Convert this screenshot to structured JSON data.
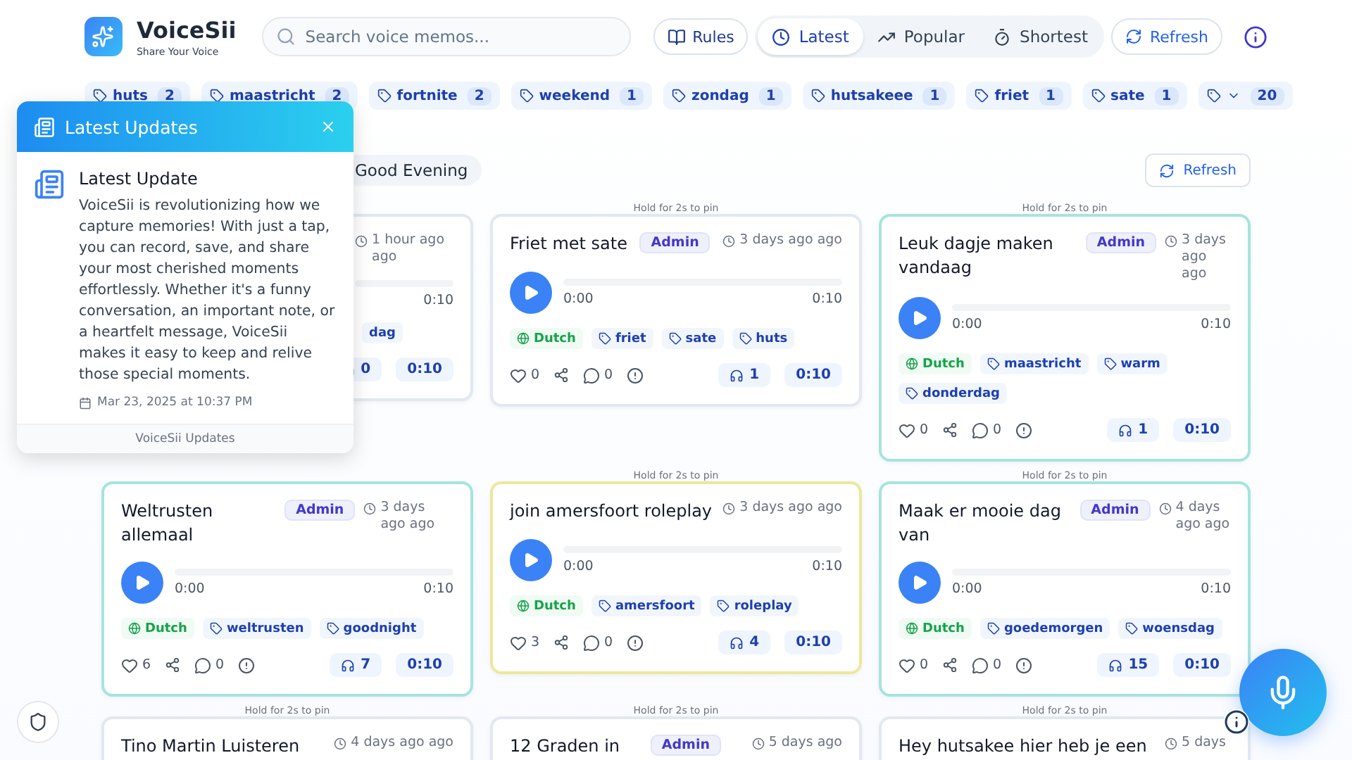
{
  "brand": {
    "name": "VoiceSii",
    "tagline": "Share Your Voice"
  },
  "search": {
    "placeholder": "Search voice memos..."
  },
  "nav": [
    {
      "kind": "link",
      "label": "Rules"
    },
    {
      "kind": "sort",
      "label": "Latest",
      "selected": true
    },
    {
      "kind": "sort",
      "label": "Popular",
      "selected": false
    },
    {
      "kind": "sort",
      "label": "Shortest",
      "selected": false
    },
    {
      "kind": "action",
      "label": "Refresh"
    }
  ],
  "tags": [
    {
      "kind": "tag",
      "label": "huts",
      "count": "2"
    },
    {
      "kind": "tag",
      "label": "maastricht",
      "count": "2"
    },
    {
      "kind": "tag",
      "label": "fortnite",
      "count": "2"
    },
    {
      "kind": "tag",
      "label": "weekend",
      "count": "1"
    },
    {
      "kind": "tag",
      "label": "zondag",
      "count": "1"
    },
    {
      "kind": "tag",
      "label": "hutsakeee",
      "count": "1"
    },
    {
      "kind": "tag",
      "label": "friet",
      "count": "1"
    },
    {
      "kind": "tag",
      "label": "sate",
      "count": "1"
    },
    {
      "kind": "more",
      "count": "20"
    }
  ],
  "greeting": "Good Evening",
  "refresh": "Refresh",
  "cards": [
    {
      "kind": "partial",
      "color": "#e2e8f0",
      "time": "1 hour ago ago",
      "audio": {
        "end": "0:10"
      },
      "tags": [
        {
          "kind": "tag",
          "label": "dag"
        }
      ],
      "listens": "0",
      "duration": "0:10"
    },
    {
      "kind": "full",
      "color": "#e2e8f0",
      "pin_hint": "Hold for 2s to pin",
      "title": "Friet met sate",
      "admin": "Admin",
      "time": "3 days ago ago",
      "audio": {
        "start": "0:00",
        "end": "0:10"
      },
      "tags": [
        {
          "kind": "language",
          "label": "Dutch"
        },
        {
          "kind": "tag",
          "label": "friet"
        },
        {
          "kind": "tag",
          "label": "sate"
        },
        {
          "kind": "tag",
          "label": "huts"
        }
      ],
      "likes": "0",
      "comments": "0",
      "listens": "1",
      "duration": "0:10"
    },
    {
      "kind": "full",
      "color": "#a5e4df",
      "pin_hint": "Hold for 2s to pin",
      "title": "Leuk dagje maken vandaag",
      "admin": "Admin",
      "time": "3 days ago ago",
      "audio": {
        "start": "0:00",
        "end": "0:10"
      },
      "tags": [
        {
          "kind": "language",
          "label": "Dutch"
        },
        {
          "kind": "tag",
          "label": "maastricht"
        },
        {
          "kind": "tag",
          "label": "warm"
        },
        {
          "kind": "tag",
          "label": "donderdag"
        }
      ],
      "likes": "0",
      "comments": "0",
      "listens": "1",
      "duration": "0:10"
    },
    {
      "kind": "full",
      "color": "#a5e4df",
      "title": "Weltrusten allemaal",
      "admin": "Admin",
      "time": "3 days ago ago",
      "audio": {
        "start": "0:00",
        "end": "0:10"
      },
      "tags": [
        {
          "kind": "language",
          "label": "Dutch"
        },
        {
          "kind": "tag",
          "label": "weltrusten"
        },
        {
          "kind": "tag",
          "label": "goodnight"
        }
      ],
      "likes": "6",
      "comments": "0",
      "listens": "7",
      "duration": "0:10"
    },
    {
      "kind": "full",
      "color": "#ece89a",
      "pin_hint": "Hold for 2s to pin",
      "title": "join amersfoort roleplay",
      "time": "3 days ago ago",
      "audio": {
        "start": "0:00",
        "end": "0:10"
      },
      "tags": [
        {
          "kind": "language",
          "label": "Dutch"
        },
        {
          "kind": "tag",
          "label": "amersfoort"
        },
        {
          "kind": "tag",
          "label": "roleplay"
        }
      ],
      "likes": "3",
      "comments": "0",
      "listens": "4",
      "duration": "0:10"
    },
    {
      "kind": "full",
      "color": "#a5e4df",
      "pin_hint": "Hold for 2s to pin",
      "title": "Maak er mooie dag van",
      "admin": "Admin",
      "time": "4 days ago ago",
      "audio": {
        "start": "0:00",
        "end": "0:10"
      },
      "tags": [
        {
          "kind": "language",
          "label": "Dutch"
        },
        {
          "kind": "tag",
          "label": "goedemorgen"
        },
        {
          "kind": "tag",
          "label": "woensdag"
        }
      ],
      "likes": "0",
      "comments": "0",
      "listens": "15",
      "duration": "0:10"
    },
    {
      "kind": "full",
      "color": "#e2e8f0",
      "pin_hint": "Hold for 2s to pin",
      "title": "Tino Martin Luisteren",
      "time": "4 days ago ago"
    },
    {
      "kind": "full",
      "color": "#e2e8f0",
      "pin_hint": "Hold for 2s to pin",
      "title": "12 Graden in",
      "admin": "Admin",
      "time": "5 days ago"
    },
    {
      "kind": "full",
      "color": "#e2e8f0",
      "pin_hint": "Hold for 2s to pin",
      "title": "Hey hutsakee hier heb je een",
      "time": "5 days"
    }
  ],
  "popup": {
    "title": "Latest Updates",
    "heading": "Latest Update",
    "body": "VoiceSii is revolutionizing how we capture memories! With just a tap, you can record, save, and share your most cherished moments effortlessly. Whether it's a funny conversation, an important note, or a heartfelt message, VoiceSii makes it easy to keep and relive those special moments.",
    "date": "Mar 23, 2025 at 10:37 PM",
    "footer": "VoiceSii Updates"
  }
}
